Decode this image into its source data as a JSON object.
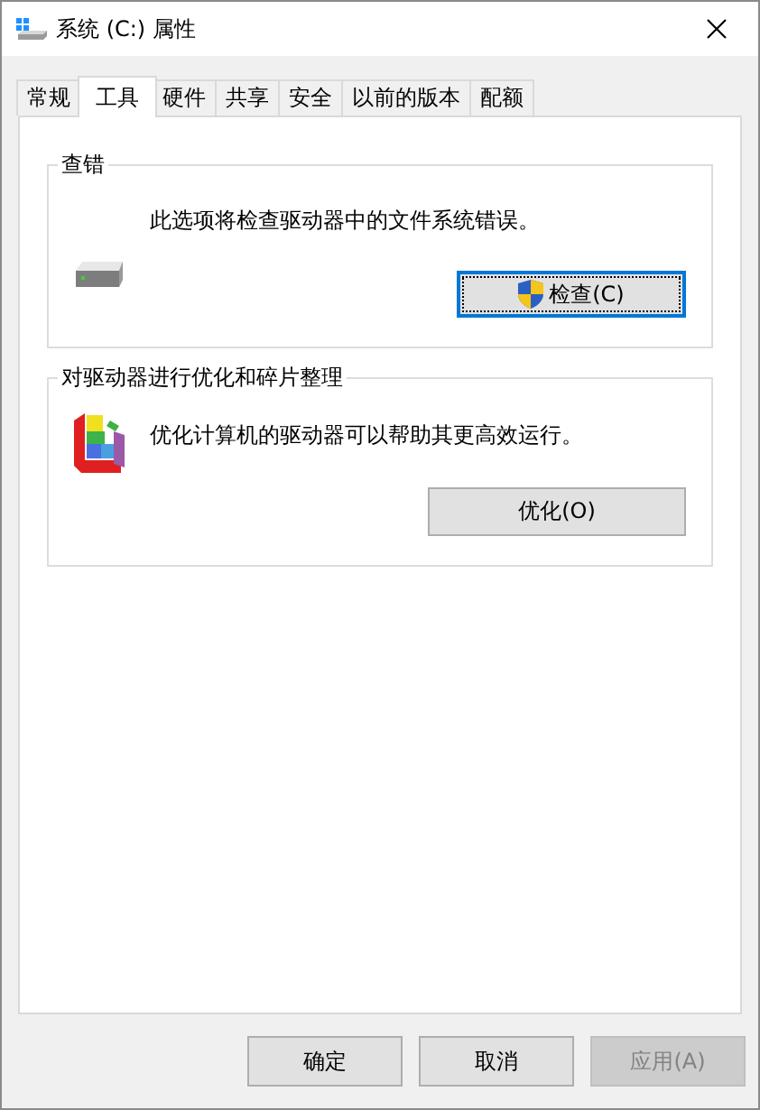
{
  "window": {
    "title": "系统 (C:) 属性"
  },
  "tabs": [
    {
      "label": "常规",
      "selected": false
    },
    {
      "label": "工具",
      "selected": true
    },
    {
      "label": "硬件",
      "selected": false
    },
    {
      "label": "共享",
      "selected": false
    },
    {
      "label": "安全",
      "selected": false
    },
    {
      "label": "以前的版本",
      "selected": false
    },
    {
      "label": "配额",
      "selected": false
    }
  ],
  "groups": [
    {
      "kind": "error-check",
      "title": "查错",
      "description": "此选项将检查驱动器中的文件系统错误。",
      "button": {
        "label": "检查(C)",
        "focused": true,
        "shield": true
      }
    },
    {
      "kind": "optimize",
      "title": "对驱动器进行优化和碎片整理",
      "description": "优化计算机的驱动器可以帮助其更高效运行。",
      "button": {
        "label": "优化(O)",
        "focused": false,
        "shield": false
      }
    }
  ],
  "buttons": [
    {
      "label": "确定",
      "disabled": false
    },
    {
      "label": "取消",
      "disabled": false
    },
    {
      "label": "应用(A)",
      "disabled": true
    }
  ]
}
